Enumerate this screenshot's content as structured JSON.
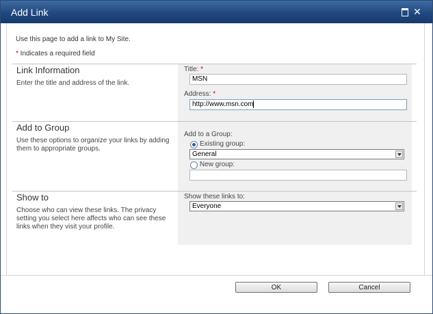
{
  "dialog": {
    "title": "Add Link",
    "maximize_icon": "maximize-icon",
    "close_icon": "close-icon",
    "close_glyph": "✕"
  },
  "intro": {
    "text": "Use this page to add a link to My Site.",
    "required_star": "*",
    "required_text": " Indicates a required field"
  },
  "sections": {
    "link_info": {
      "heading": "Link Information",
      "description": "Enter the title and address of the link.",
      "title_label": "Title: ",
      "title_star": "*",
      "title_value": "MSN",
      "address_label": "Address: ",
      "address_star": "*",
      "address_value": "http://www.msn.com"
    },
    "add_to_group": {
      "heading": "Add to Group",
      "description": "Use these options to organize your links by adding them to appropriate groups.",
      "group_label": "Add to a Group:",
      "existing_label": "Existing group:",
      "existing_value": "General",
      "new_label": "New group:",
      "new_value": ""
    },
    "show_to": {
      "heading": "Show to",
      "description": "Choose who can view these links. The privacy setting you select here affects who can see these links when they visit your profile.",
      "show_label": "Show these links to:",
      "show_value": "Everyone"
    }
  },
  "footer": {
    "ok_label": "OK",
    "cancel_label": "Cancel"
  }
}
